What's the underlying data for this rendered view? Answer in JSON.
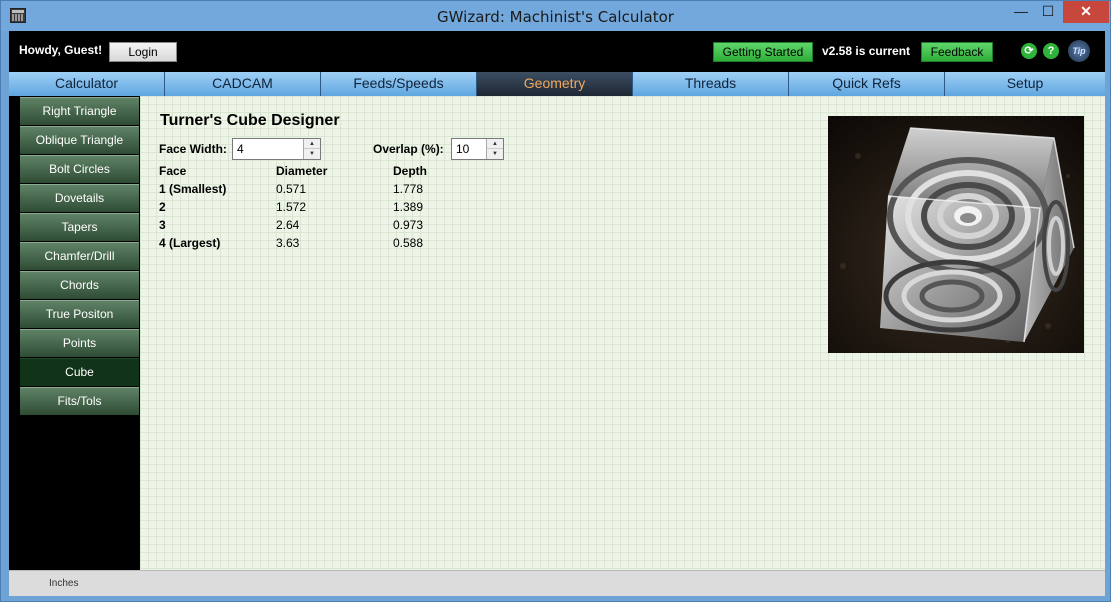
{
  "window": {
    "title": "GWizard: Machinist's Calculator",
    "minimize": "—",
    "maximize": "☐",
    "close": "✕"
  },
  "topbar": {
    "greeting": "Howdy, Guest!",
    "login_label": "Login",
    "getting_started_label": "Getting Started",
    "version_text": "v2.58 is current",
    "feedback_label": "Feedback",
    "help_glyph": "?",
    "refresh_glyph": "⟳",
    "tip_label": "Tip"
  },
  "tabs": [
    {
      "label": "Calculator"
    },
    {
      "label": "CADCAM"
    },
    {
      "label": "Feeds/Speeds"
    },
    {
      "label": "Geometry",
      "active": true
    },
    {
      "label": "Threads"
    },
    {
      "label": "Quick Refs"
    },
    {
      "label": "Setup"
    }
  ],
  "sidebar": {
    "items": [
      {
        "label": "Right Triangle"
      },
      {
        "label": "Oblique Triangle"
      },
      {
        "label": "Bolt Circles"
      },
      {
        "label": "Dovetails"
      },
      {
        "label": "Tapers"
      },
      {
        "label": "Chamfer/Drill"
      },
      {
        "label": "Chords"
      },
      {
        "label": "True Positon"
      },
      {
        "label": "Points"
      },
      {
        "label": "Cube",
        "active": true
      },
      {
        "label": "Fits/Tols"
      }
    ]
  },
  "main": {
    "title": "Turner's Cube Designer",
    "face_width_label": "Face Width:",
    "face_width_value": "4",
    "overlap_label": "Overlap (%):",
    "overlap_value": "10",
    "table": {
      "headers": [
        "Face",
        "Diameter",
        "Depth"
      ],
      "rows": [
        [
          "1 (Smallest)",
          "0.571",
          "1.778"
        ],
        [
          "2",
          "1.572",
          "1.389"
        ],
        [
          "3",
          "2.64",
          "0.973"
        ],
        [
          "4 (Largest)",
          "3.63",
          "0.588"
        ]
      ]
    }
  },
  "status": {
    "units": "Inches"
  },
  "colors": {
    "accent_tab": "#f1a85b",
    "green_button": "#2fae3a",
    "sidebar_button": "#3e5f44",
    "grid_bg": "#eef5e8"
  }
}
